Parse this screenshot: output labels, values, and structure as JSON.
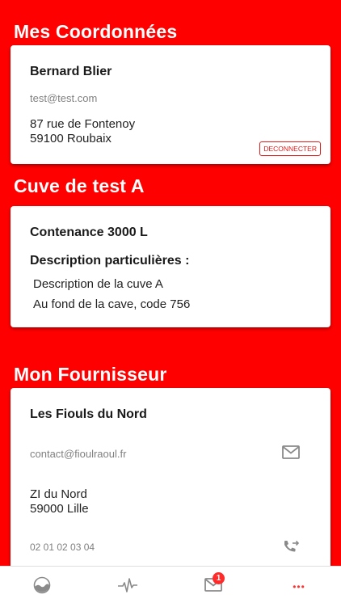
{
  "coordonnees": {
    "title": "Mes Coordonnées",
    "name": "Bernard Blier",
    "email": "test@test.com",
    "address_line1": "87 rue de Fontenoy",
    "address_line2": "59100 Roubaix",
    "disconnect_label": "DECONNECTER"
  },
  "cuve": {
    "title": "Cuve de test A",
    "capacity": "Contenance 3000 L",
    "description_label": "Description particulières :",
    "description_line1": "Description de la cuve A",
    "description_line2": "Au fond de la cave, code 756"
  },
  "fournisseur": {
    "title": "Mon Fournisseur",
    "name": "Les Fiouls du Nord",
    "email": "contact@fioulraoul.fr",
    "address_line1": "ZI du Nord",
    "address_line2": "59000 Lille",
    "phone": "02 01 02 03 04"
  },
  "tabbar": {
    "messages_badge": "1",
    "more_label": "•••",
    "accent": "#ff0000"
  }
}
